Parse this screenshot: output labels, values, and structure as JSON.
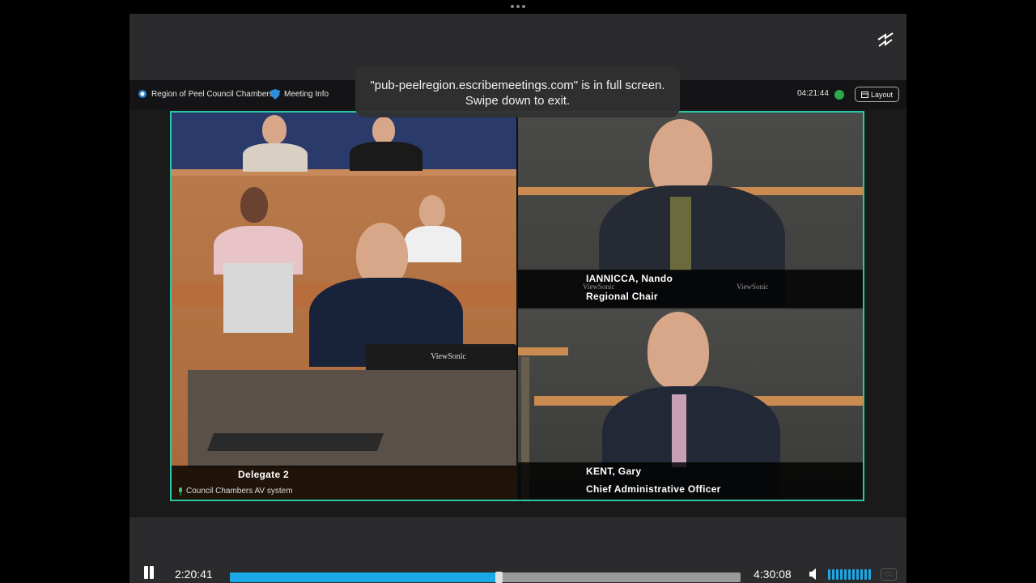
{
  "toast": {
    "line1": "\"pub-peelregion.escribemeetings.com\" is in full screen.",
    "line2": "Swipe down to exit."
  },
  "stream_header": {
    "channel": "Region of Peel Council Chambers",
    "meeting_info": "Meeting Info",
    "clock": "04:21:44",
    "layout_label": "Layout"
  },
  "tiles": {
    "left": {
      "name": "Delegate 2",
      "footer": "Council Chambers AV system",
      "monitor_brand": "ViewSonic"
    },
    "top_right": {
      "name": "IANNICCA, Nando",
      "title": "Regional Chair",
      "monitor_brand_a": "ViewSonic",
      "monitor_brand_b": "ViewSonic"
    },
    "bottom_right": {
      "name": "KENT, Gary",
      "title": "Chief Administrative Officer"
    }
  },
  "player": {
    "current_time": "2:20:41",
    "duration": "4:30:08",
    "progress_fraction": 0.52,
    "cc_label": "CC",
    "accent_color": "#1aa8e6"
  },
  "icons": [
    "more-handle-icon",
    "exit-fullscreen-icon",
    "peel-logo-icon",
    "info-shield-icon",
    "live-indicator-icon",
    "layout-icon",
    "pause-icon",
    "volume-icon",
    "mic-icon"
  ]
}
